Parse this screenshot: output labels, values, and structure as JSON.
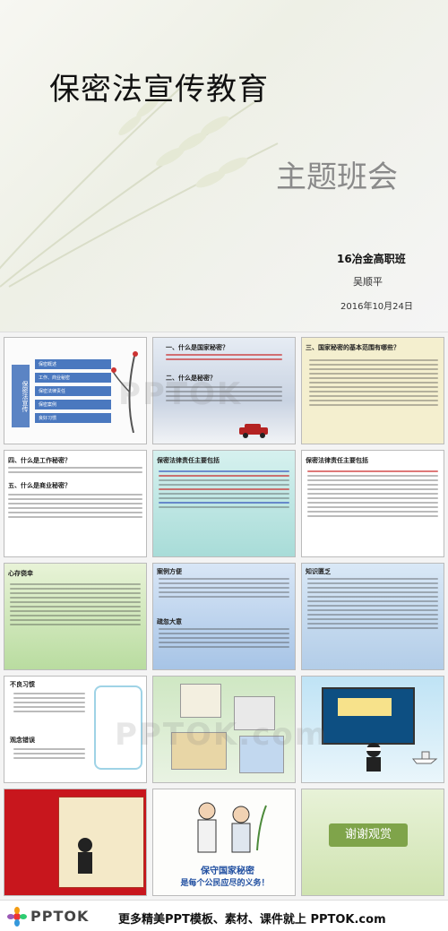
{
  "hero": {
    "title": "保密法宣传教育",
    "subtitle": "主题班会",
    "class_name": "16冶金高职班",
    "author": "吴顺平",
    "date": "2016年10月24日"
  },
  "slides": [
    {
      "menu": [
        "保密概述",
        "工作、商业秘密",
        "保密法律责任",
        "保密案例",
        "良好习惯"
      ],
      "side_text": "保密法宣传"
    },
    {
      "h1": "一、什么是国家秘密？",
      "h2": "二、什么是秘密？"
    },
    {
      "h1": "三、国家秘密的基本范围有哪些？"
    },
    {
      "h1": "四、什么是工作秘密？",
      "h2": "五、什么是商业秘密？"
    },
    {
      "h1": "保密法律责任主要包括"
    },
    {
      "h1": "保密法律责任主要包括"
    },
    {
      "h1": "心存侥幸"
    },
    {
      "h1": "案例方便",
      "h2": "疏忽大意"
    },
    {
      "h1": "知识匮乏"
    },
    {
      "h1": "不良习惯",
      "h2": "观念错误"
    },
    {},
    {},
    {},
    {
      "caption_line1": "保守国家秘密",
      "caption_line2": "是每个公民应尽的义务！"
    },
    {
      "thanks": "谢谢观赏"
    }
  ],
  "watermark": "PPTOK",
  "watermark_domain": "PPTOK.com",
  "footer": {
    "logo_text": "PPTOK",
    "slogan": "更多精美PPT模板、素材、课件就上 PPTOK.com"
  }
}
